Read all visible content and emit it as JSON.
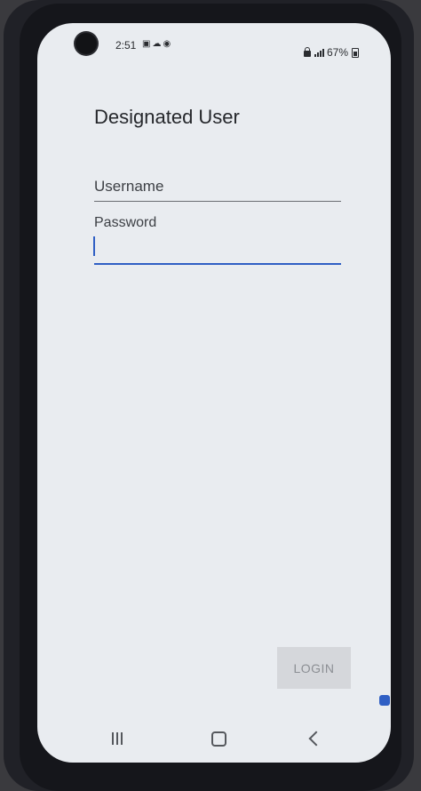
{
  "status_bar": {
    "time": "2:51",
    "battery": "67%"
  },
  "page": {
    "title": "Designated User"
  },
  "form": {
    "username_label": "Username",
    "username_value": "",
    "password_label": "Password",
    "password_value": ""
  },
  "login_button": {
    "label": "LOGIN"
  },
  "nav": {
    "items": [
      "recents",
      "home",
      "back"
    ]
  },
  "colors": {
    "accent": "#2f5fc4",
    "background": "#e9ecf0",
    "button_disabled": "#d5d7db"
  }
}
